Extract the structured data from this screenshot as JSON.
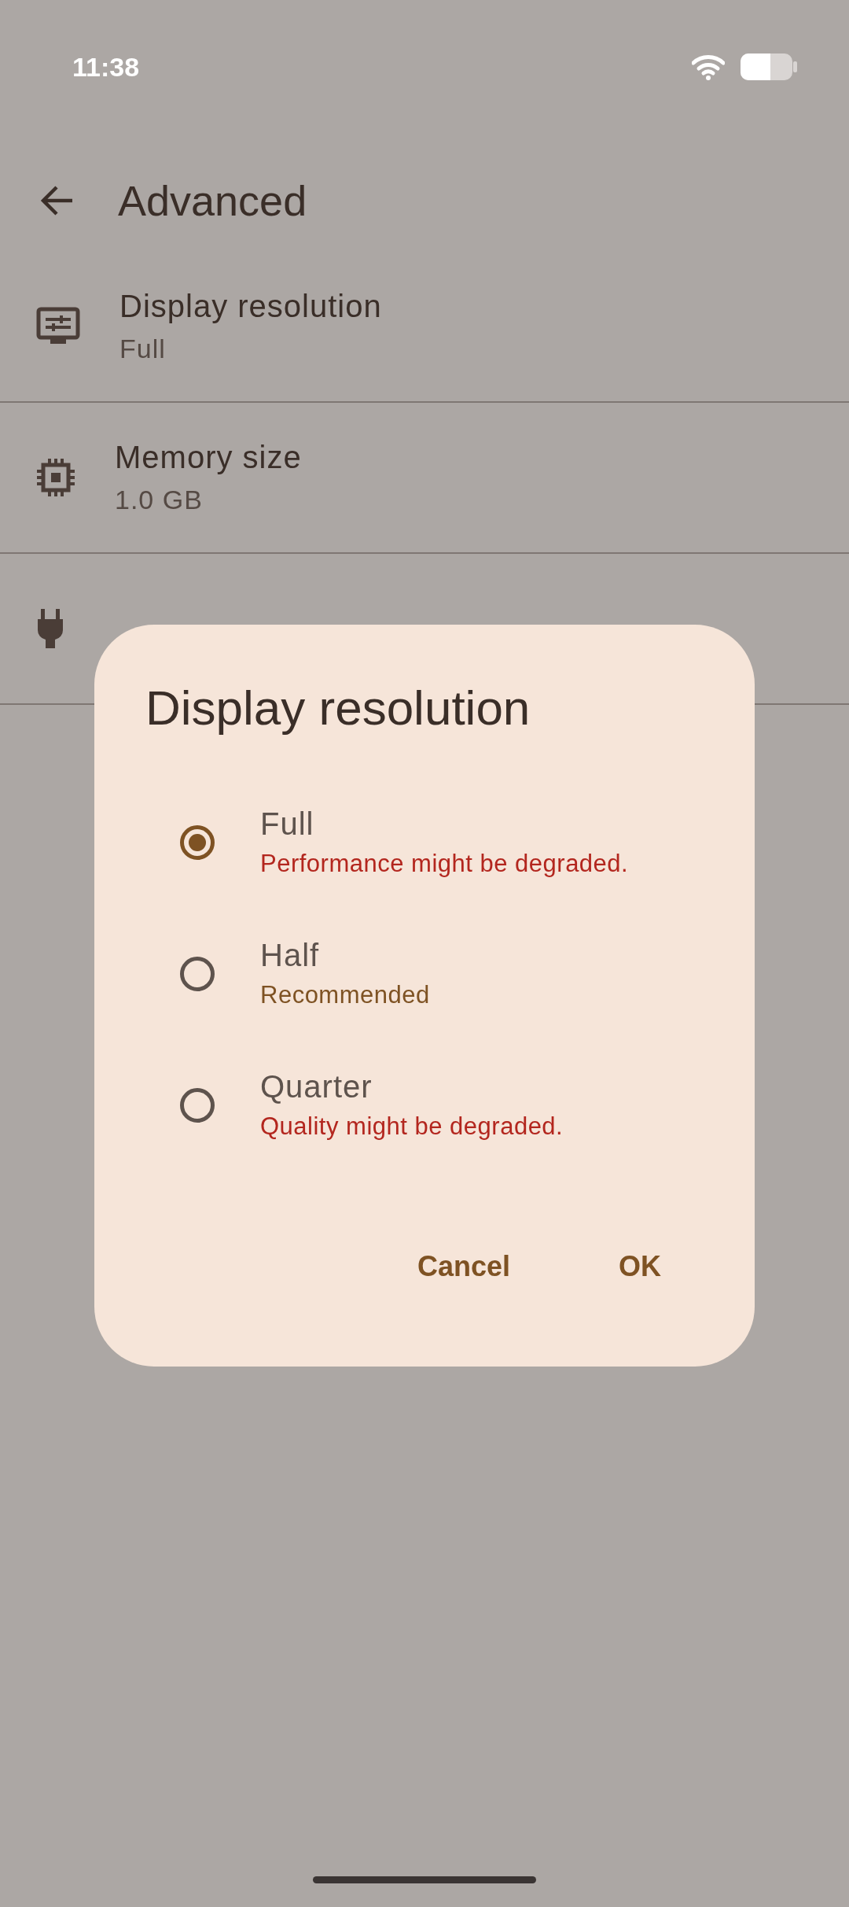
{
  "status_bar": {
    "time": "11:38"
  },
  "app_bar": {
    "title": "Advanced"
  },
  "settings": [
    {
      "kind": "display",
      "title": "Display resolution",
      "summary": "Full"
    },
    {
      "kind": "memory",
      "title": "Memory size",
      "summary": "1.0 GB"
    },
    {
      "kind": "plug"
    }
  ],
  "dialog": {
    "title": "Display resolution",
    "options": [
      {
        "label": "Full",
        "note": "Performance might be degraded.",
        "color": "#b3261e",
        "selected": true
      },
      {
        "label": "Half",
        "note": "Recommended",
        "color": "#7e5223",
        "selected": false
      },
      {
        "label": "Quarter",
        "note": "Quality might be degraded.",
        "color": "#b3261e",
        "selected": false
      }
    ],
    "buttons": [
      "Cancel",
      "OK"
    ]
  }
}
